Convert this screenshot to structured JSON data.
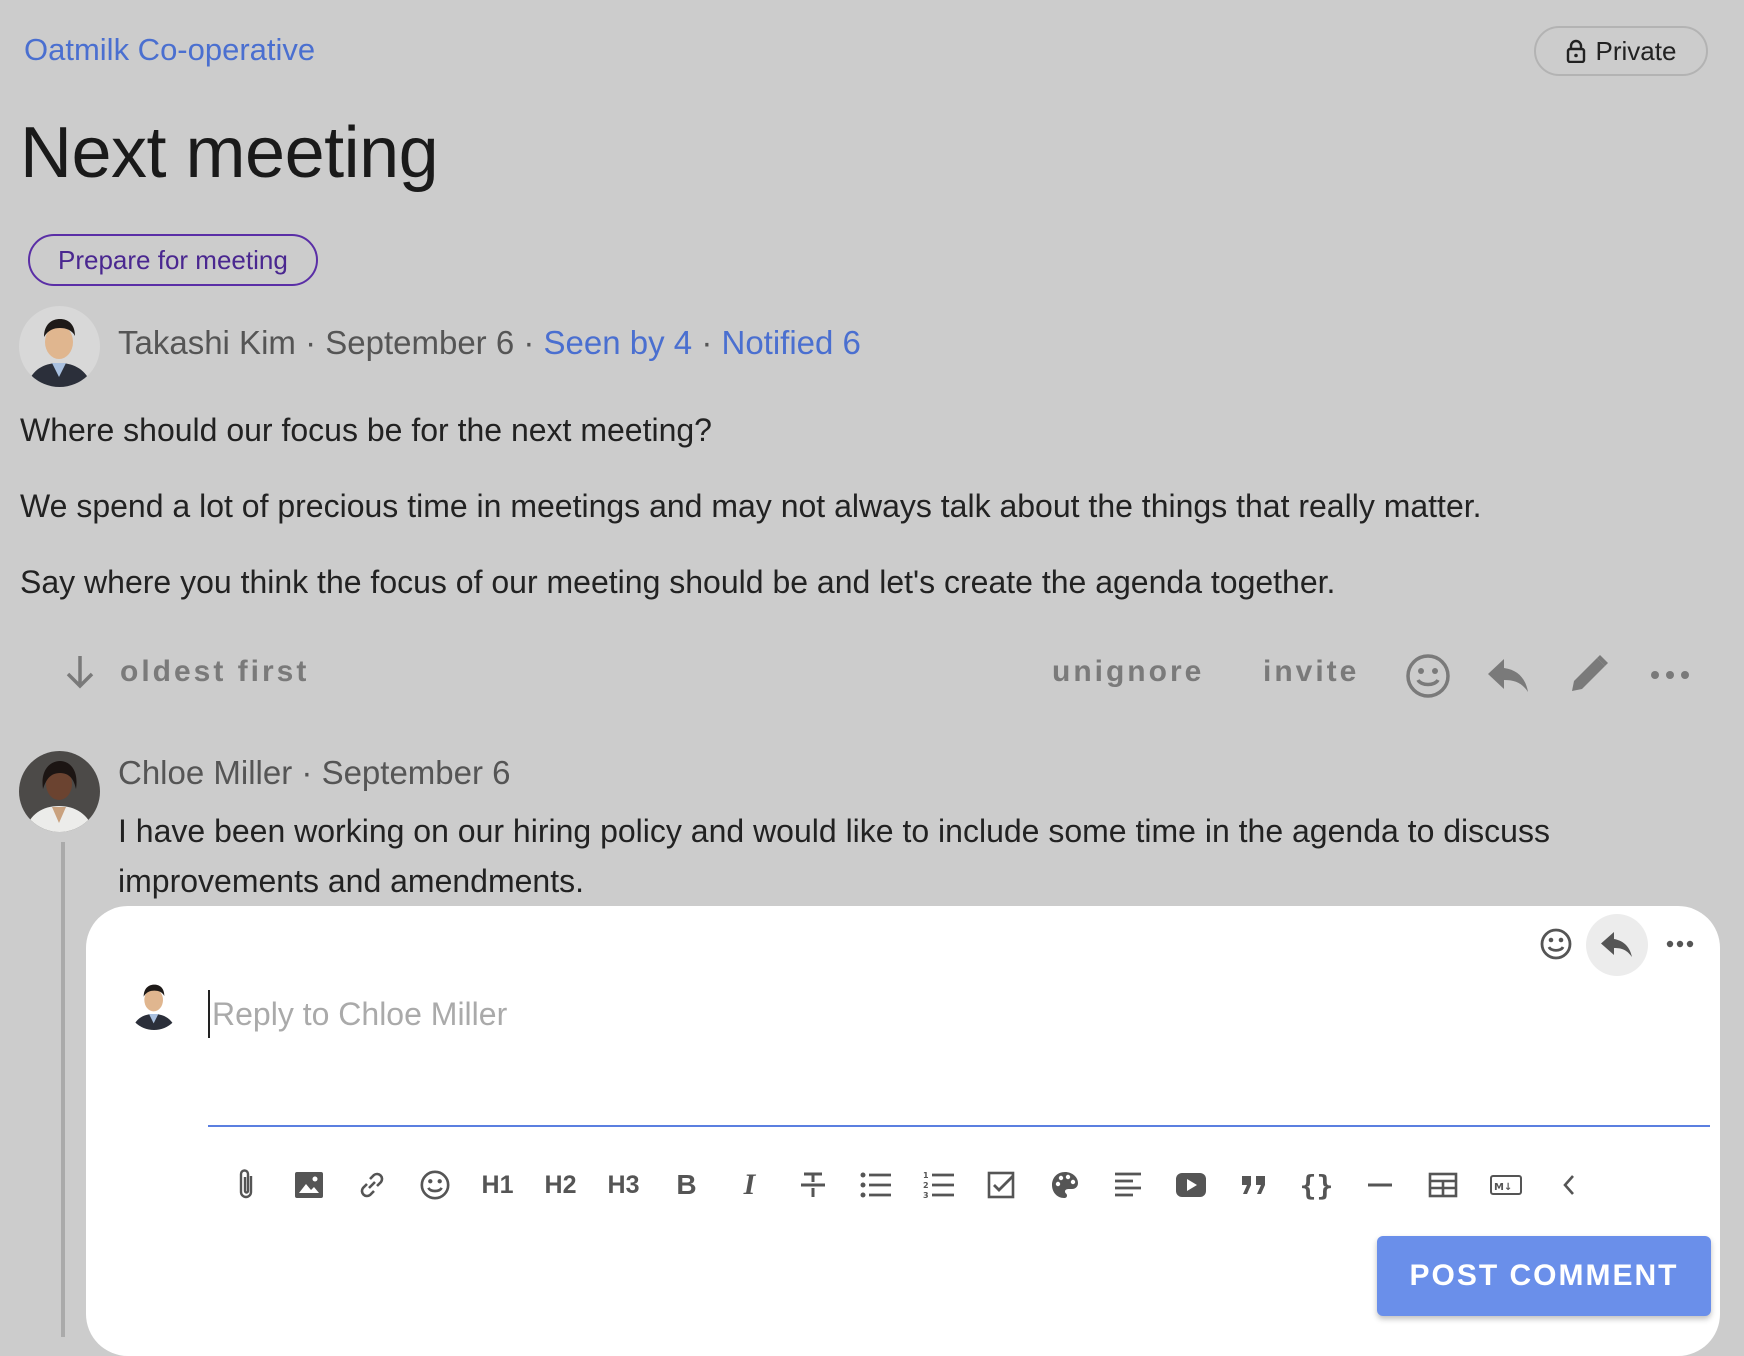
{
  "header": {
    "group_name": "Oatmilk Co-operative",
    "privacy_label": "Private"
  },
  "discussion": {
    "title": "Next meeting",
    "tag_label": "Prepare for meeting",
    "author": "Takashi Kim",
    "date": "September 6",
    "seen_by": "Seen by 4",
    "notified": "Notified 6",
    "sep": "·",
    "paragraphs": [
      "Where should our focus be for the next meeting?",
      "We spend a lot of precious time in meetings and may not always talk about the things that really matter.",
      "Say where you think the focus of our meeting should be and let's create the agenda together."
    ]
  },
  "actions": {
    "sort_label": "oldest first",
    "unignore_label": "unignore",
    "invite_label": "invite"
  },
  "comment": {
    "author": "Chloe Miller",
    "date": "September 6",
    "text": "I have been working on our hiring policy and would like to include some time in the agenda to discuss improvements and amendments."
  },
  "reply": {
    "placeholder": "Reply to Chloe Miller",
    "post_label": "POST COMMENT",
    "toolbar": [
      "attach",
      "image",
      "link",
      "emoji",
      "H1",
      "H2",
      "H3",
      "bold",
      "italic",
      "strikethrough",
      "bullet-list",
      "numbered-list",
      "task-list",
      "color",
      "align",
      "video",
      "quote",
      "code",
      "divider",
      "table",
      "markdown",
      "collapse"
    ]
  },
  "colors": {
    "background": "#cccccc",
    "link": "#4a6fd0",
    "tag_border": "#5a2ea6",
    "primary_button": "#6a8fea"
  }
}
